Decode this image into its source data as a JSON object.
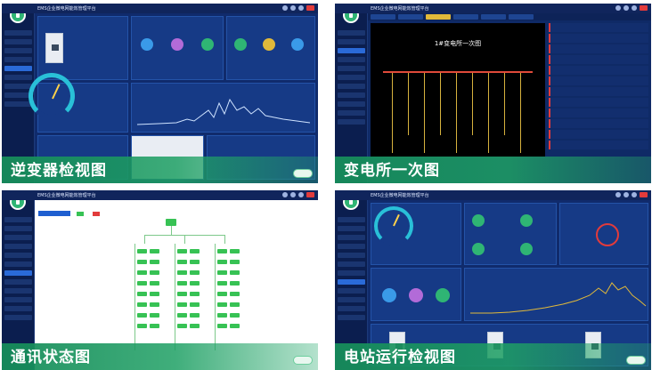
{
  "tiles": [
    {
      "id": "inverter-detail",
      "caption": "逆变器检视图",
      "app_title": "EMS企业微电网能效管理平台"
    },
    {
      "id": "substation-diagram",
      "caption": "变电所一次图",
      "app_title": "EMS企业微电网能效管理平台",
      "diagram_title": "1#变电所一次图"
    },
    {
      "id": "comm-status",
      "caption": "通讯状态图",
      "app_title": "EMS企业微电网能效管理平台"
    },
    {
      "id": "station-monitor",
      "caption": "电站运行检视图",
      "app_title": "EMS企业微电网能效管理平台"
    }
  ],
  "colors": {
    "accent_green": "#1ea064",
    "app_blue": "#102b6c",
    "alarm_red": "#e23b3b"
  }
}
